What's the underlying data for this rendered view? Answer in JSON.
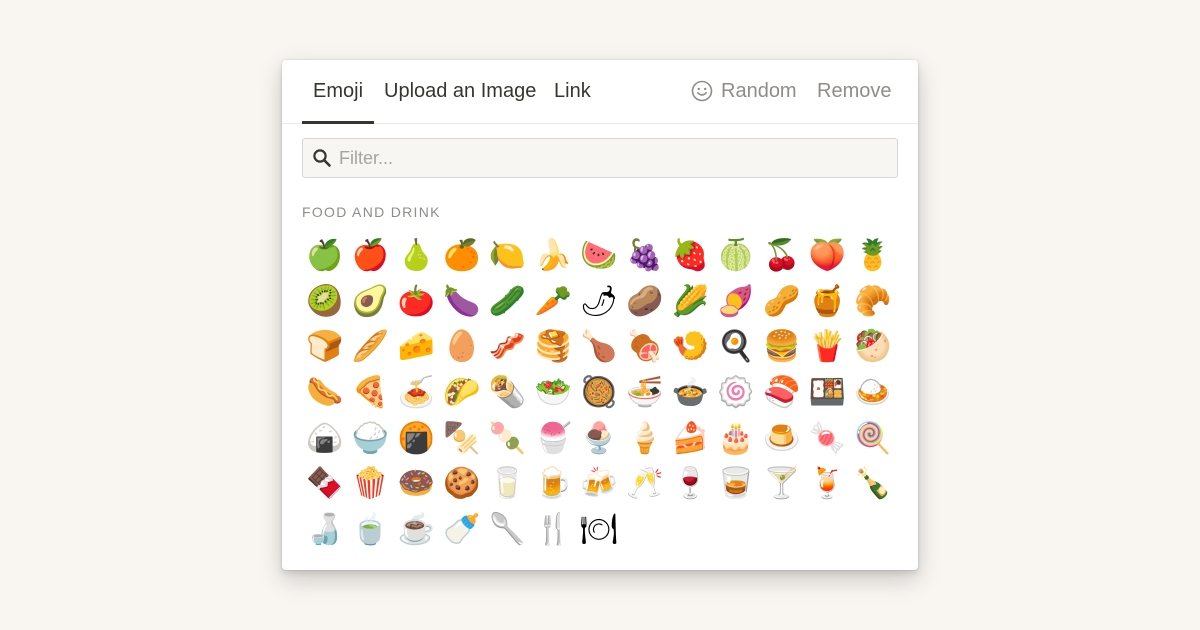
{
  "tabs": {
    "emoji": "Emoji",
    "upload": "Upload an Image",
    "link": "Link"
  },
  "actions": {
    "random": "Random",
    "remove": "Remove"
  },
  "filter": {
    "placeholder": "Filter...",
    "value": ""
  },
  "section": {
    "title": "FOOD AND DRINK"
  },
  "emojis": [
    "🍏",
    "🍎",
    "🍐",
    "🍊",
    "🍋",
    "🍌",
    "🍉",
    "🍇",
    "🍓",
    "🍈",
    "🍒",
    "🍑",
    "🍍",
    "🥝",
    "🥑",
    "🍅",
    "🍆",
    "🥒",
    "🥕",
    "🌶",
    "🥔",
    "🌽",
    "🍠",
    "🥜",
    "🍯",
    "🥐",
    "🍞",
    "🥖",
    "🧀",
    "🥚",
    "🥓",
    "🥞",
    "🍗",
    "🍖",
    "🍤",
    "🍳",
    "🍔",
    "🍟",
    "🥙",
    "🌭",
    "🍕",
    "🍝",
    "🌮",
    "🌯",
    "🥗",
    "🥘",
    "🍜",
    "🍲",
    "🍥",
    "🍣",
    "🍱",
    "🍛",
    "🍙",
    "🍚",
    "🍘",
    "🍢",
    "🍡",
    "🍧",
    "🍨",
    "🍦",
    "🍰",
    "🎂",
    "🍮",
    "🍬",
    "🍭",
    "🍫",
    "🍿",
    "🍩",
    "🍪",
    "🥛",
    "🍺",
    "🍻",
    "🥂",
    "🍷",
    "🥃",
    "🍸",
    "🍹",
    "🍾",
    "🍶",
    "🍵",
    "☕",
    "🍼",
    "🥄",
    "🍴",
    "🍽"
  ],
  "colors": {
    "text": "#37352f",
    "muted": "#8f8d89",
    "background": "#f9f5f1"
  }
}
